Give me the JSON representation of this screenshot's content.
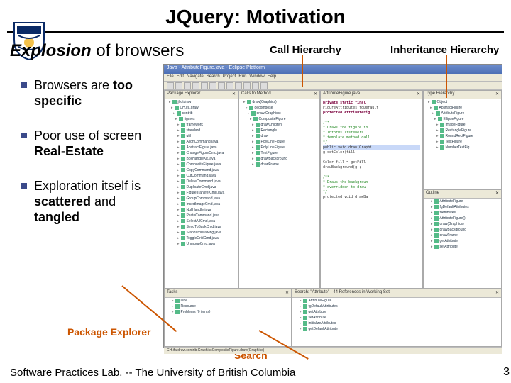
{
  "title": "JQuery: Motivation",
  "subtitle_em": "Explosion",
  "subtitle_rest": "of browsers",
  "labels": {
    "call": "Call Hierarchy",
    "inheritance": "Inheritance Hierarchy",
    "package": "Package Explorer",
    "search": "Search"
  },
  "bullets": [
    {
      "pre": "Browsers are",
      "strong": "too specific",
      "post": ""
    },
    {
      "pre": "Poor use of screen ",
      "strong": "Real-Estate",
      "post": ""
    },
    {
      "pre": "Exploration itself is ",
      "strong": "scattered",
      "post": " and ",
      "strong2": "tangled"
    }
  ],
  "footer": "Software Practices Lab. -- The University of British Columbia",
  "page": "3",
  "ide": {
    "title": "Java - AttributeFigure.java - Eclipse Platform",
    "menu": [
      "File",
      "Edit",
      "Navigate",
      "Search",
      "Project",
      "Run",
      "Window",
      "Help"
    ],
    "pkg_tab": "Package Explorer",
    "call_tab": "Calls to Method",
    "inh_tab": "Type Hierarchy",
    "outline_tab": "Outline",
    "tasks_tab": "Tasks",
    "search_tab": "Search: \"Attribute\" - 44 References in Working Set",
    "status": "CH.ifa.draw.contrib.GraphicsCompositeFigure.draw(Graphics)",
    "pkg_items": [
      "jhotdraw",
      "CH.ifa.draw",
      "contrib",
      "figures",
      "framework",
      "standard",
      "util",
      "AlignCommand.java",
      "AbstractFigure.java",
      "ChangeFigureCmd.java",
      "BoxHandleKit.java",
      "CompositeFigure.java",
      "CopyCommand.java",
      "CutCommand.java",
      "DeleteCommand.java",
      "DuplicateCmd.java",
      "FigureTransferCmd.java",
      "GroupCommand.java",
      "InsertImageCmd.java",
      "NullHandle.java",
      "PasteCommand.java",
      "SelectAllCmd.java",
      "SendToBackCmd.java",
      "StandardDrawing.java",
      "ToggleGridCmd.java",
      "UngroupCmd.java"
    ],
    "call_items": [
      "draw(Graphics)",
      "decompose",
      "draw(Graphics)",
      "CompositeFigure",
      "drawChildren",
      "Rectangle",
      "draw",
      "PolyLineFigure",
      "PolyLineFigure",
      "TextFigure",
      "drawBackground",
      "drawFrame"
    ],
    "inh_items": [
      "Object",
      "AbstractFigure",
      "AttributeFigure",
      "EllipseFigure",
      "ImageFigure",
      "RectangleFigure",
      "RoundRectFigure",
      "TextFigure",
      "NumberTextFig"
    ],
    "outline_items": [
      "AttributeFigure",
      "fgDefaultAttributes",
      "fAttributes",
      "AttributeFigure()",
      "draw(Graphics)",
      "drawBackground",
      "drawFrame",
      "getAttribute",
      "setAttribute"
    ],
    "code_lines": [
      {
        "t": "private static final",
        "c": "kw"
      },
      {
        "t": "  FigureAttributes fgDefault",
        "c": ""
      },
      {
        "t": "protected AttributeFig",
        "c": "kw"
      },
      {
        "t": "",
        "c": ""
      },
      {
        "t": "/**",
        "c": "cm"
      },
      {
        "t": " * Draws the figure in",
        "c": "cm"
      },
      {
        "t": " * Informs listeners",
        "c": "cm"
      },
      {
        "t": " * template method call",
        "c": "cm"
      },
      {
        "t": " */",
        "c": "cm"
      },
      {
        "t": "public void draw(Graphi",
        "c": "hl"
      },
      {
        "t": "  g.setColor(fill);",
        "c": ""
      },
      {
        "t": "",
        "c": ""
      },
      {
        "t": "  Color fill = getFill",
        "c": ""
      },
      {
        "t": "  drawBackground(g);",
        "c": ""
      },
      {
        "t": "",
        "c": ""
      },
      {
        "t": "/**",
        "c": "cm"
      },
      {
        "t": " * Draws the backgroun",
        "c": "cm"
      },
      {
        "t": " * overridden to draw",
        "c": "cm"
      },
      {
        "t": " */",
        "c": "cm"
      },
      {
        "t": "protected void drawBa",
        "c": ""
      }
    ],
    "tasks": [
      "Line",
      "Resource",
      "Problems (0 items)"
    ],
    "search_items": [
      "AttributeFigure",
      "fgDefaultAttributes",
      "getAttribute",
      "setAttribute",
      "initializeAttributes",
      "getDefaultAttribute"
    ]
  }
}
